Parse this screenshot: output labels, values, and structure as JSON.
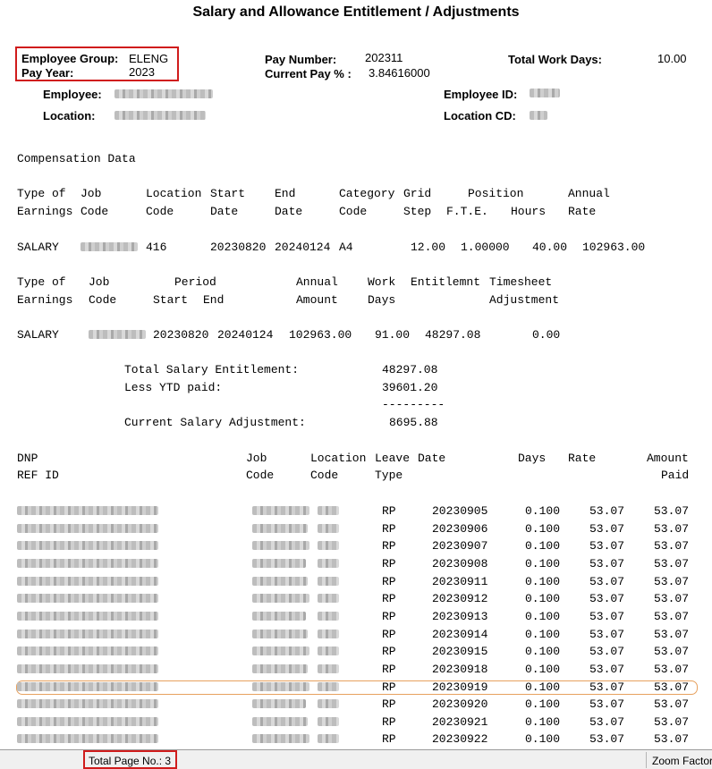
{
  "report": {
    "title": "Salary and Allowance Entitlement / Adjustments",
    "employee_group_label": "Employee Group:",
    "employee_group": "ELENG",
    "pay_year_label": "Pay Year:",
    "pay_year": "2023",
    "pay_number_label": "Pay Number:",
    "pay_number": "202311",
    "current_pay_pct_label": "Current Pay % :",
    "current_pay_pct": "3.84616000",
    "total_work_days_label": "Total Work Days:",
    "total_work_days": "10.00",
    "employee_label": "Employee:",
    "employee_id_label": "Employee ID:",
    "location_label": "Location:",
    "location_cd_label": "Location CD:"
  },
  "compensation": {
    "section_title": "Compensation Data",
    "headers1": [
      "Type of",
      "Job",
      "Location",
      "Start",
      "End",
      "Category",
      "Grid",
      "Position",
      "Annual"
    ],
    "headers1b": [
      "Earnings",
      "Code",
      "Code",
      "Date",
      "Date",
      "Code",
      "Step",
      "F.T.E.",
      "Hours",
      "Rate"
    ],
    "row": {
      "type": "SALARY",
      "location": "416",
      "start": "20230820",
      "end": "20240124",
      "category": "A4",
      "grid_step": "12.00",
      "fte": "1.00000",
      "hours": "40.00",
      "rate": "102963.00"
    }
  },
  "entitlement": {
    "headers1": [
      "Type of",
      "Job",
      "Period",
      "Annual",
      "Work",
      "Entitlemnt",
      "Timesheet"
    ],
    "headers2": [
      "Earnings",
      "Code",
      "Start",
      "End",
      "Amount",
      "Days",
      "Adjustment"
    ],
    "row": {
      "type": "SALARY",
      "start": "20230820",
      "end": "20240124",
      "annual": "102963.00",
      "days": "91.00",
      "entitlement": "48297.08",
      "adjustment": "0.00"
    }
  },
  "summary": {
    "total_label": "Total Salary Entitlement:",
    "total": "48297.08",
    "less_label": "Less YTD paid:",
    "less": "39601.20",
    "divider": "---------",
    "current_label": "Current Salary Adjustment:",
    "current": "8695.88"
  },
  "dnp": {
    "headers1": [
      "DNP",
      "Job",
      "Location",
      "Leave",
      "Date",
      "Days",
      "Rate",
      "Amount"
    ],
    "headers2": [
      "REF ID",
      "Code",
      "Code",
      "Type",
      "Paid"
    ],
    "rows": [
      {
        "type": "RP",
        "date": "20230905",
        "days": "0.100",
        "rate": "53.07",
        "amount": "53.07"
      },
      {
        "type": "RP",
        "date": "20230906",
        "days": "0.100",
        "rate": "53.07",
        "amount": "53.07"
      },
      {
        "type": "RP",
        "date": "20230907",
        "days": "0.100",
        "rate": "53.07",
        "amount": "53.07"
      },
      {
        "type": "RP",
        "date": "20230908",
        "days": "0.100",
        "rate": "53.07",
        "amount": "53.07"
      },
      {
        "type": "RP",
        "date": "20230911",
        "days": "0.100",
        "rate": "53.07",
        "amount": "53.07"
      },
      {
        "type": "RP",
        "date": "20230912",
        "days": "0.100",
        "rate": "53.07",
        "amount": "53.07"
      },
      {
        "type": "RP",
        "date": "20230913",
        "days": "0.100",
        "rate": "53.07",
        "amount": "53.07"
      },
      {
        "type": "RP",
        "date": "20230914",
        "days": "0.100",
        "rate": "53.07",
        "amount": "53.07"
      },
      {
        "type": "RP",
        "date": "20230915",
        "days": "0.100",
        "rate": "53.07",
        "amount": "53.07"
      },
      {
        "type": "RP",
        "date": "20230918",
        "days": "0.100",
        "rate": "53.07",
        "amount": "53.07"
      },
      {
        "type": "RP",
        "date": "20230919",
        "days": "0.100",
        "rate": "53.07",
        "amount": "53.07"
      },
      {
        "type": "RP",
        "date": "20230920",
        "days": "0.100",
        "rate": "53.07",
        "amount": "53.07"
      },
      {
        "type": "RP",
        "date": "20230921",
        "days": "0.100",
        "rate": "53.07",
        "amount": "53.07"
      },
      {
        "type": "RP",
        "date": "20230922",
        "days": "0.100",
        "rate": "53.07",
        "amount": "53.07"
      }
    ]
  },
  "statusbar": {
    "total_pages": "Total Page No.: 3",
    "zoom": "Zoom Factor"
  },
  "colors": {
    "annotation_red": "#d01c1c",
    "row_highlight": "#e7a15e"
  }
}
